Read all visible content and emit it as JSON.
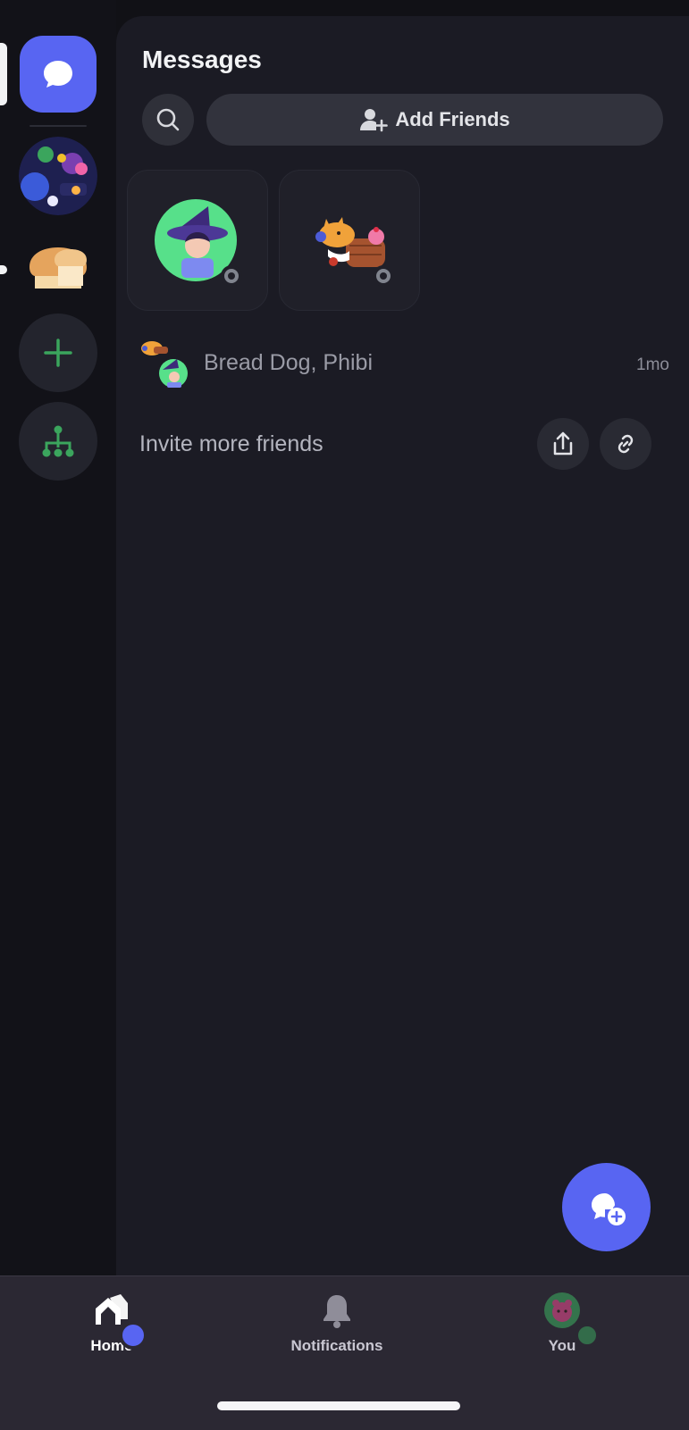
{
  "header": {
    "title": "Messages"
  },
  "actions": {
    "add_friends_label": "Add Friends"
  },
  "dm_list": [
    {
      "names": "Bread Dog, Phibi",
      "time": "1mo"
    }
  ],
  "invite": {
    "label": "Invite more friends"
  },
  "tabs": [
    {
      "label": "Home"
    },
    {
      "label": "Notifications"
    },
    {
      "label": "You"
    }
  ],
  "colors": {
    "accent": "#5865f2",
    "background": "#1b1b24",
    "rail": "#121218",
    "green": "#3ba55d"
  }
}
